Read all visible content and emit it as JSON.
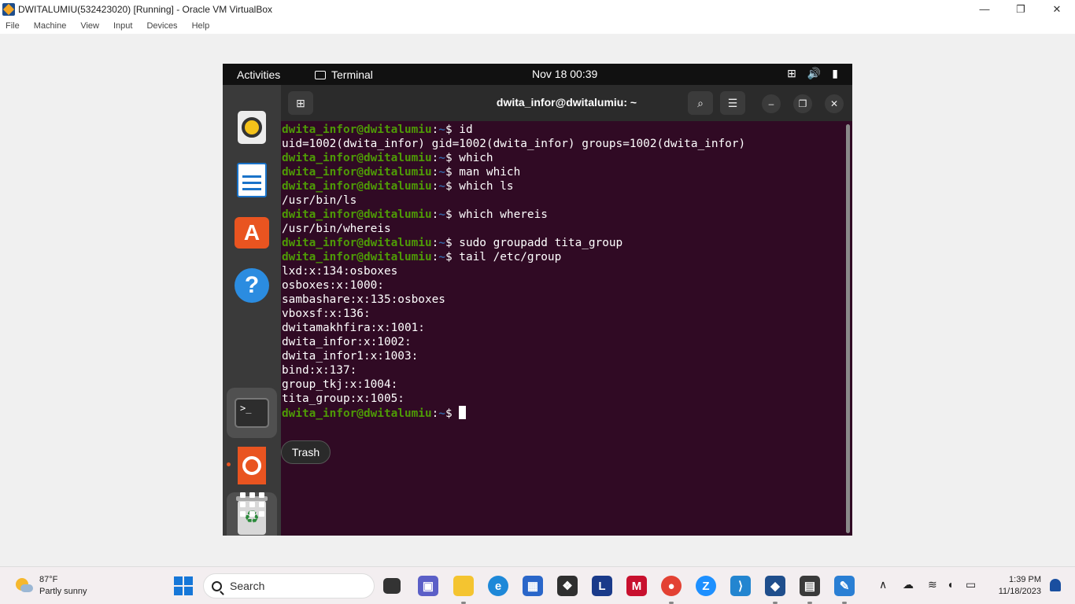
{
  "vbox": {
    "title": "DWITALUMIU(532423020) [Running] - Oracle VM VirtualBox",
    "menu": [
      "File",
      "Machine",
      "View",
      "Input",
      "Devices",
      "Help"
    ],
    "win_buttons": [
      "—",
      "❐",
      "✕"
    ]
  },
  "gnome": {
    "activities": "Activities",
    "app_name": "Terminal",
    "clock": "Nov 18  00:39",
    "dock_tooltip": "Trash"
  },
  "terminal": {
    "title": "dwita_infor@dwitalumiu: ~",
    "user_host": "dwita_infor@dwitalumiu",
    "path": "~",
    "lines": [
      {
        "type": "prompt",
        "cmd": "id"
      },
      {
        "type": "out",
        "text": "uid=1002(dwita_infor) gid=1002(dwita_infor) groups=1002(dwita_infor)"
      },
      {
        "type": "prompt",
        "cmd": "which"
      },
      {
        "type": "prompt",
        "cmd": "man which"
      },
      {
        "type": "prompt",
        "cmd": "which ls"
      },
      {
        "type": "out",
        "text": "/usr/bin/ls"
      },
      {
        "type": "prompt",
        "cmd": "which whereis"
      },
      {
        "type": "out",
        "text": "/usr/bin/whereis"
      },
      {
        "type": "prompt",
        "cmd": "sudo groupadd tita_group"
      },
      {
        "type": "prompt",
        "cmd": "tail /etc/group"
      },
      {
        "type": "out",
        "text": "lxd:x:134:osboxes"
      },
      {
        "type": "out",
        "text": "osboxes:x:1000:"
      },
      {
        "type": "out",
        "text": "sambashare:x:135:osboxes"
      },
      {
        "type": "out",
        "text": "vboxsf:x:136:"
      },
      {
        "type": "out",
        "text": "dwitamakhfira:x:1001:"
      },
      {
        "type": "out",
        "text": "dwita_infor:x:1002:"
      },
      {
        "type": "out",
        "text": "dwita_infor1:x:1003:"
      },
      {
        "type": "out",
        "text": "bind:x:137:"
      },
      {
        "type": "out",
        "text": "group_tkj:x:1004:"
      },
      {
        "type": "out",
        "text": "tita_group:x:1005:"
      },
      {
        "type": "prompt",
        "cmd": "",
        "cursor": true
      }
    ]
  },
  "taskbar": {
    "weather_temp": "87°F",
    "weather_desc": "Partly sunny",
    "search_placeholder": "Search",
    "time": "1:39 PM",
    "date": "11/18/2023"
  },
  "colors": {
    "terminal_bg": "#300a24",
    "prompt_user": "#4e9a06",
    "prompt_path": "#3465a4",
    "ubuntu_orange": "#e95420"
  }
}
